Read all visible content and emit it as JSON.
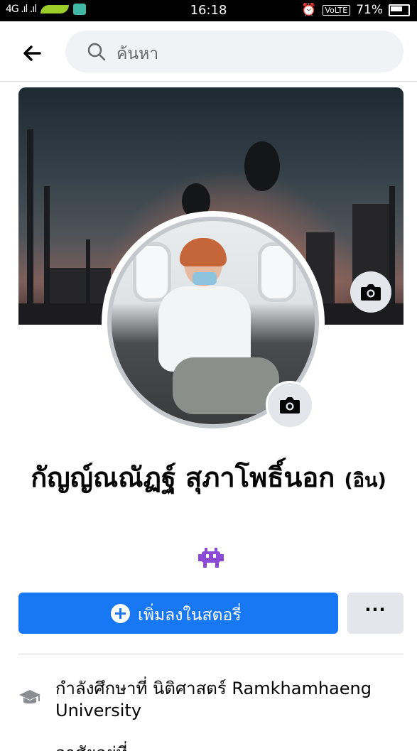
{
  "status_bar": {
    "signal": "4G .ıl .ıl",
    "time": "16:18",
    "volte": "VoLTE",
    "battery": "71%"
  },
  "search": {
    "placeholder": "ค้นหา"
  },
  "profile": {
    "name": "กัญญ์ณณัฏฐ์ สุภาโพธิ์นอก",
    "alt_name": "(อิน)",
    "bio_emoji": "👾"
  },
  "actions": {
    "add_story_label": "เพิ่มลงในสตอรี่",
    "more_label": "···"
  },
  "intro": {
    "education": "กำลังศึกษาที่ นิติศาสตร์ Ramkhamhaeng University",
    "next_item_partial": "อาศัยอยู่ที่"
  },
  "colors": {
    "accent": "#1877f2",
    "search_bg": "#f0f2f5",
    "secondary_button": "#e4e6eb"
  }
}
